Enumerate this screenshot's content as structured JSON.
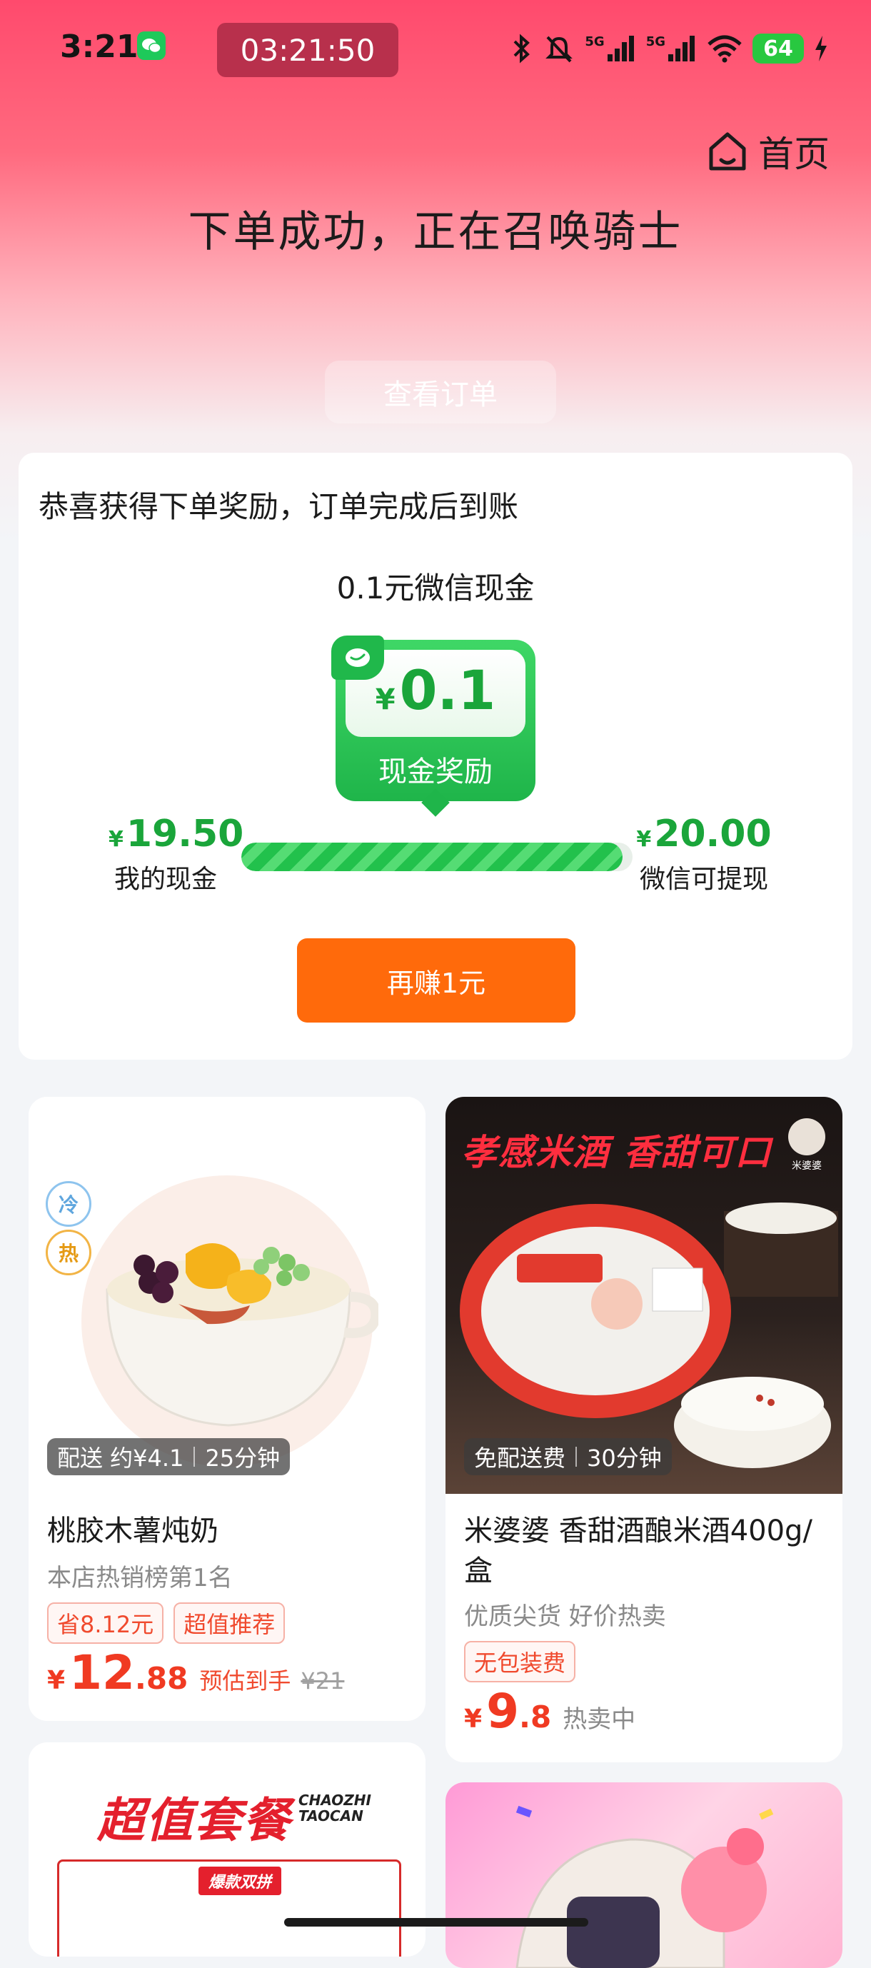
{
  "status_bar": {
    "time": "3:21",
    "timer": "03:21:50",
    "network_5g_1": "5G",
    "network_5g_2": "5G",
    "battery": "64"
  },
  "header": {
    "home_label": "首页",
    "headline": "下单成功，正在召唤骑士",
    "view_order_label": "查看订单"
  },
  "reward": {
    "title": "恭喜获得下单奖励，订单完成后到账",
    "amount_text": "0.1元微信现金",
    "badge_currency": "¥",
    "badge_value": "0.1",
    "badge_label": "现金奖励",
    "my_cash_currency": "¥",
    "my_cash_value": "19.50",
    "my_cash_label": "我的现金",
    "withdraw_currency": "¥",
    "withdraw_value": "20.00",
    "withdraw_label": "微信可提现",
    "progress_fraction": 0.975,
    "earn_button_label": "再赚1元"
  },
  "products": [
    {
      "hot_cold": [
        "冷",
        "热"
      ],
      "delivery": "配送 约¥4.1",
      "delivery_time": "25分钟",
      "name": "桃胶木薯炖奶",
      "subtitle": "本店热销榜第1名",
      "tags": [
        "省8.12元",
        "超值推荐"
      ],
      "price_currency": "¥",
      "price_int": "12",
      "price_dec": ".88",
      "price_note": "预估到手",
      "original_price": "¥21"
    },
    {
      "banner": "孝感米酒  香甜可口",
      "brand": "米婆婆",
      "delivery": "免配送费",
      "delivery_time": "30分钟",
      "name": "米婆婆 香甜酒酿米酒400g/盒",
      "subtitle": "优质尖货 好价热卖",
      "tags": [
        "无包装费"
      ],
      "price_currency": "¥",
      "price_int": "9",
      "price_dec": ".8",
      "price_note": "热卖中"
    },
    {
      "title": "超值套餐",
      "subtitle_line1": "CHAOZHI",
      "subtitle_line2": "TAOCAN",
      "tag": "爆款双拼"
    }
  ],
  "colors": {
    "accent_green": "#1aa53a",
    "price_red": "#f03a22",
    "button_orange": "#ff6a0b",
    "header_pink": "#ff4a6d"
  },
  "icons": [
    "wechat-icon",
    "bluetooth-icon",
    "mute-icon",
    "signal-icon",
    "wifi-icon",
    "charging-icon",
    "home-icon"
  ]
}
